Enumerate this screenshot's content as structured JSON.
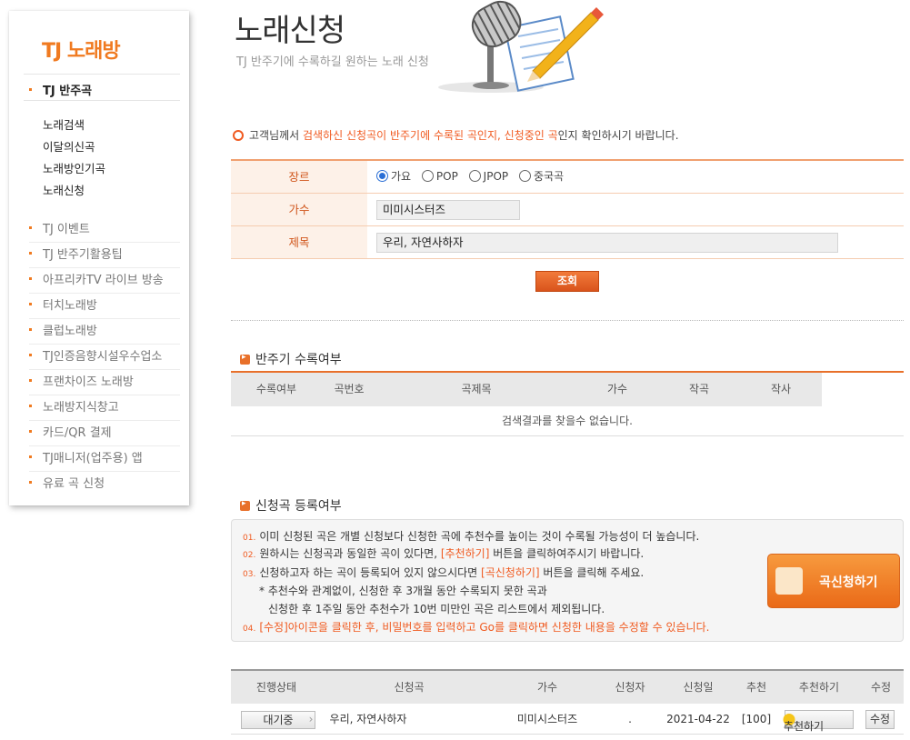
{
  "sidebar": {
    "logo": "TJ 노래방",
    "section_title": "TJ 반주곡",
    "subitems": [
      "노래검색",
      "이달의신곡",
      "노래방인기곡",
      "노래신청"
    ],
    "menu": [
      "TJ 이벤트",
      "TJ 반주기활용팁",
      "아프리카TV 라이브 방송",
      "터치노래방",
      "클럽노래방",
      "TJ인증음향시설우수업소",
      "프랜차이즈 노래방",
      "노래방지식창고",
      "카드/QR 결제",
      "TJ매니저(업주용) 앱",
      "유료 곡 신청"
    ]
  },
  "header": {
    "title": "노래신청",
    "subtitle": "TJ 반주기에 수록하길 원하는 노래 신청"
  },
  "notice": {
    "prefix": "고객님께서 ",
    "highlight1": "검색하신 신청곡이 반주기에 수록된 곡인지, 신청중인 곡",
    "suffix": "인지 확인하시기 바랍니다."
  },
  "form": {
    "genre_label": "장르",
    "genres": [
      "가요",
      "POP",
      "JPOP",
      "중국곡"
    ],
    "selected_genre": "가요",
    "singer_label": "가수",
    "singer_value": "미미시스터즈",
    "title_label": "제목",
    "title_value": "우리, 자연사하자",
    "search_button": "조회"
  },
  "result": {
    "section_title": "반주기 수록여부",
    "columns": [
      "수록여부",
      "곡번호",
      "곡제목",
      "가수",
      "작곡",
      "작사"
    ],
    "empty_message": "검색결과를 찾을수 없습니다."
  },
  "requests": {
    "section_title": "신청곡 등록여부",
    "lines": {
      "l1_num": "01.",
      "l1": "이미 신청된 곡은 개별 신청보다 신청한 곡에 추천수를 높이는 것이 수록될 가능성이 더 높습니다.",
      "l2_num": "02.",
      "l2a": "원하시는 신청곡과 동일한 곡이 있다면, ",
      "l2b": "[추천하기]",
      "l2c": " 버튼을 클릭하여주시기 바랍니다.",
      "l3_num": "03.",
      "l3a": "신청하고자 하는 곡이 등록되어 있지 않으시다면 ",
      "l3b": "[곡신청하기]",
      "l3c": " 버튼을 클릭해 주세요.",
      "note1": "* 추천수와 관계없이, 신청한 후 3개월 동안 수록되지 못한 곡과",
      "note2": "신청한 후 1주일 동안 추천수가 10번 미만인 곡은 리스트에서 제외됩니다.",
      "l4_num": "04.",
      "l4": "[수정]아이콘을 클릭한 후, 비밀번호를 입력하고 Go를 클릭하면 신청한 내용을 수정할 수 있습니다."
    },
    "request_button": "곡신청하기",
    "columns": [
      "진행상태",
      "신청곡",
      "가수",
      "신청자",
      "신청일",
      "추천",
      "추천하기",
      "수정"
    ],
    "rows": [
      {
        "status": "대기중",
        "song": "우리, 자연사하자",
        "singer": "미미시스터즈",
        "requester": ".",
        "date": "2021-04-22",
        "recommend": "[100]",
        "recommend_button": "추천하기",
        "edit_button": "수정"
      }
    ]
  },
  "colors": {
    "accent": "#f07a20",
    "highlight": "#f05a20",
    "label_bg": "#fdf1e8"
  }
}
